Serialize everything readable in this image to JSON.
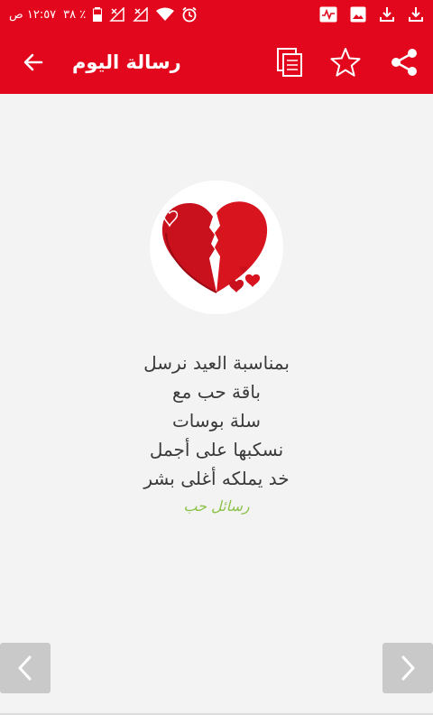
{
  "status_bar": {
    "time": "١٢:٥٧ ص",
    "battery": "٣٨ ٪",
    "icons_left": [
      "battery-icon",
      "signal-icon",
      "signal-icon",
      "wifi-icon",
      "alarm-icon"
    ],
    "icons_right": [
      "activity-icon",
      "image-icon",
      "download-icon",
      "download-icon"
    ],
    "bg_color": "#e2071c"
  },
  "app_bar": {
    "title": "رسالة اليوم",
    "back_icon": "arrow-back-icon",
    "actions": [
      "copy-icon",
      "star-icon",
      "share-icon"
    ]
  },
  "message": {
    "lines": [
      "بمناسبة العيد نرسل",
      "باقة حب مع",
      "سلة بوسات",
      "نسكبها على أجمل",
      "خد يملكه أغلى بشر"
    ],
    "signature": "رسائل حب",
    "signature_color": "#8bc34a"
  },
  "navigation": {
    "prev_icon": "chevron-left-icon",
    "next_icon": "chevron-right-icon"
  }
}
